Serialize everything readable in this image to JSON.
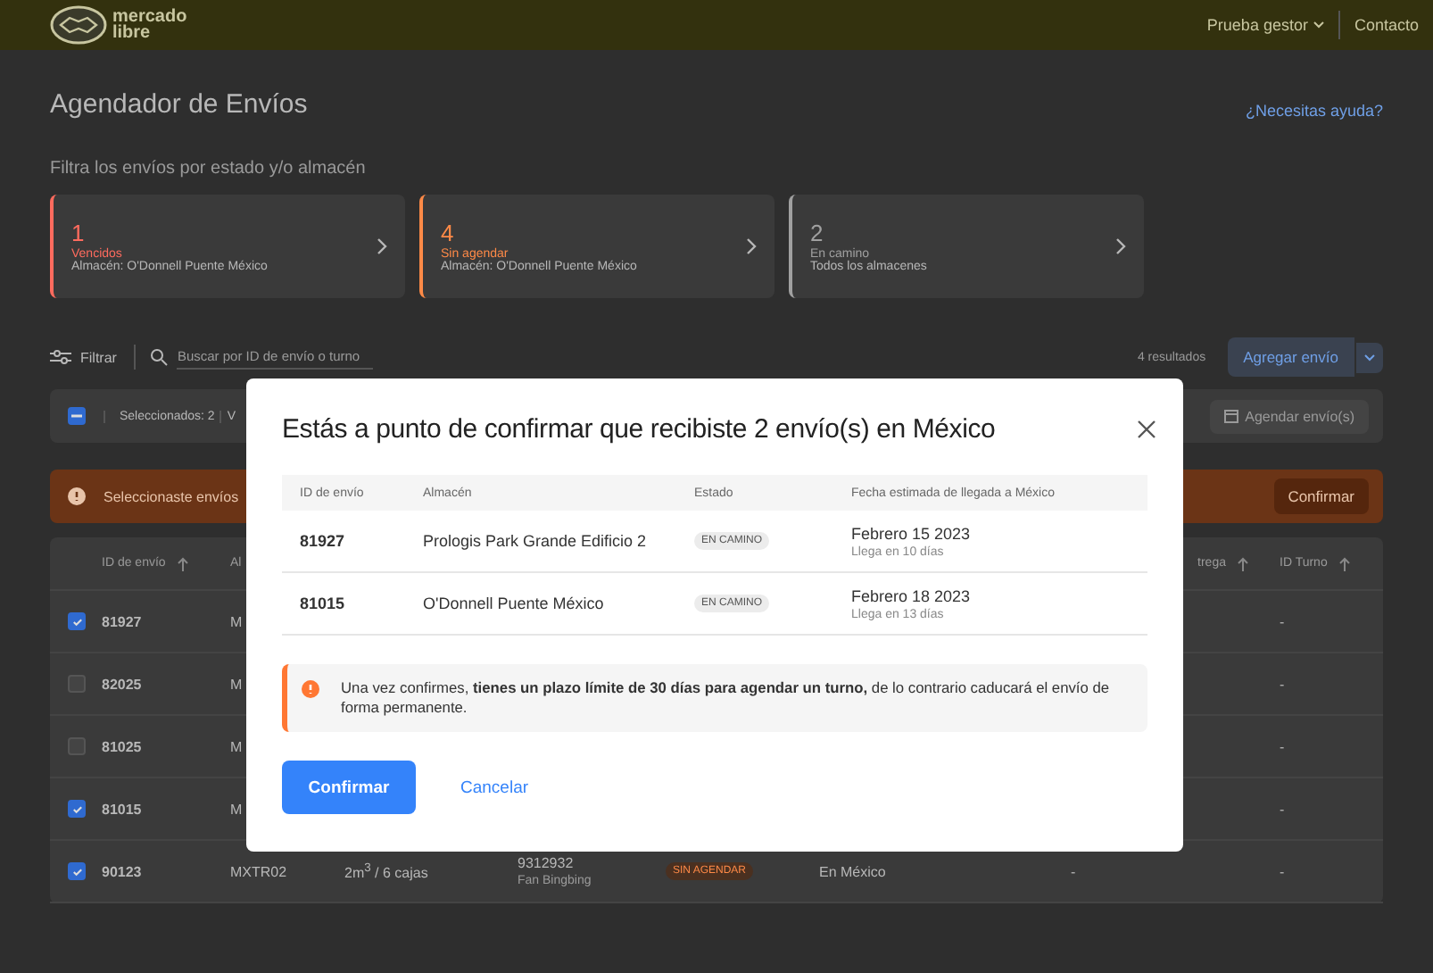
{
  "header": {
    "logo_lines": [
      "mercado",
      "libre"
    ],
    "user_menu": "Prueba gestor",
    "contact_link": "Contacto"
  },
  "page": {
    "title": "Agendador de Envíos",
    "help_link": "¿Necesitas ayuda?",
    "filter_label": "Filtra los envíos por estado y/o almacén"
  },
  "cards": [
    {
      "count": "1",
      "label": "Vencidos",
      "subtitle": "Almacén: O'Donnell Puente México",
      "color": "#ff6b5e"
    },
    {
      "count": "4",
      "label": "Sin agendar",
      "subtitle": "Almacén: O'Donnell Puente México",
      "color": "#ff8a47"
    },
    {
      "count": "2",
      "label": "En camino",
      "subtitle": "Todos los almacenes",
      "color": "#a0a0a0"
    }
  ],
  "toolbar": {
    "filter_button": "Filtrar",
    "search": {
      "placeholder": "Buscar por ID de envío o turno"
    },
    "results": "4 resultados",
    "add_button": "Agregar envío"
  },
  "selection_bar": {
    "indeterminate": true,
    "selected_text": "Seleccionados: 2",
    "cut_text": "V",
    "schedule_button": "Agendar envío(s)"
  },
  "banner": {
    "text": "Seleccionaste envíos",
    "button": "Confirmar"
  },
  "table": {
    "columns": [
      {
        "label": "ID de envío",
        "sortable": true
      },
      {
        "label": "Al"
      },
      {
        "label": "trega",
        "sortable": true
      },
      {
        "label": "ID Turno",
        "sortable": true
      }
    ],
    "rows": [
      {
        "checked": true,
        "id": "81927",
        "warehouse": "M",
        "turno": "-"
      },
      {
        "checked": false,
        "id": "82025",
        "warehouse": "M",
        "turno": "-"
      },
      {
        "checked": false,
        "id": "81025",
        "warehouse": "M",
        "turno": "-"
      },
      {
        "checked": true,
        "id": "81015",
        "warehouse": "M",
        "turno": "-"
      },
      {
        "checked": true,
        "id": "90123",
        "warehouse": "MXTR02",
        "volume": "2m$^{3}$ / 6 cajas",
        "order": "9312932",
        "order_sub": "Fan Bingbing",
        "status": {
          "label": "SIN AGENDAR",
          "kind": "sin_agendar"
        },
        "location": "En México",
        "delivery": "-",
        "turno": "-"
      }
    ]
  },
  "modal": {
    "title": "Estás a punto de confirmar que recibiste 2 envío(s) en México",
    "columns": [
      "ID de envío",
      "Almacén",
      "Estado",
      "Fecha estimada de llegada a México"
    ],
    "rows": [
      {
        "id": "81927",
        "warehouse": "Prologis Park Grande Edificio 2",
        "status": {
          "label": "EN CAMINO",
          "kind": "en_camino"
        },
        "date": "Febrero 15 2023",
        "eta": "Llega en 10 días"
      },
      {
        "id": "81015",
        "warehouse": "O'Donnell Puente México",
        "status": {
          "label": "EN CAMINO",
          "kind": "en_camino"
        },
        "date": "Febrero 18 2023",
        "eta": "Llega en 13 días"
      }
    ],
    "alert": "Una vez confirmes, **tienes un plazo límite de 30 días para agendar un turno,** de lo contrario caducará el envío de forma permanente.",
    "confirm_button": "Confirmar",
    "cancel_button": "Cancelar"
  }
}
